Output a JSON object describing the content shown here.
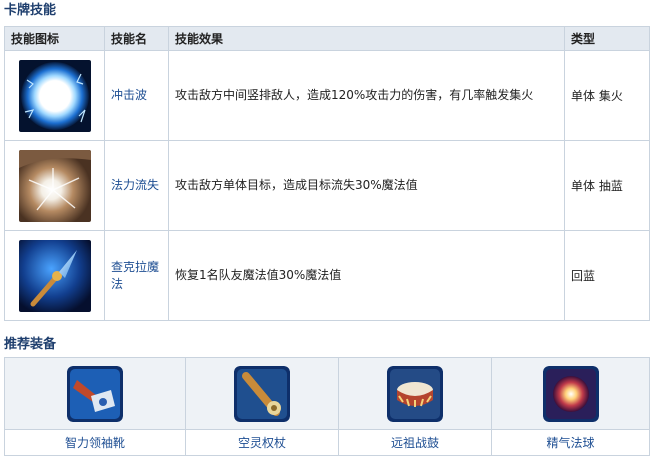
{
  "sections": {
    "skills_title": "卡牌技能",
    "equip_title": "推荐装备"
  },
  "skills_table": {
    "headers": [
      "技能图标",
      "技能名",
      "技能效果",
      "类型"
    ],
    "rows": [
      {
        "icon": "shockwave-skill-icon",
        "name": "冲击波",
        "effect": "攻击敌方中间竖排敌人，造成120%攻击力的伤害，有几率触发集火",
        "type": "单体 集火"
      },
      {
        "icon": "mana-drain-skill-icon",
        "name": "法力流失",
        "effect": "攻击敌方单体目标，造成目标流失30%魔法值",
        "type": "单体 抽蓝"
      },
      {
        "icon": "chakra-magic-skill-icon",
        "name": "查克拉魔法",
        "effect": "恢复1名队友魔法值30%魔法值",
        "type": "回蓝"
      }
    ]
  },
  "equipment": [
    {
      "icon": "sobi-mask-boots-icon",
      "name": "智力领袖靴"
    },
    {
      "icon": "ghost-scepter-icon",
      "name": "空灵权杖"
    },
    {
      "icon": "ancestral-drum-icon",
      "name": "远祖战鼓"
    },
    {
      "icon": "essence-orb-icon",
      "name": "精气法球"
    }
  ]
}
